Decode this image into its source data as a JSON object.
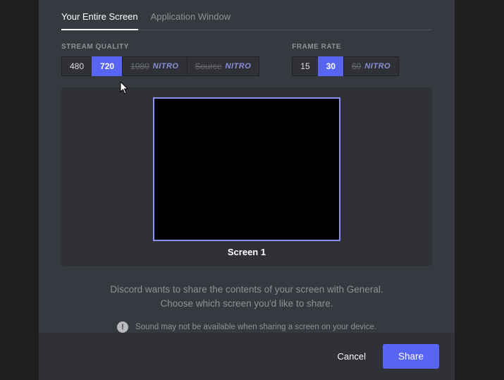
{
  "tabs": {
    "entire_screen": "Your Entire Screen",
    "application_window": "Application Window",
    "active_index": 0
  },
  "stream_quality": {
    "label": "STREAM QUALITY",
    "options": [
      {
        "text": "480",
        "selected": false,
        "locked": false
      },
      {
        "text": "720",
        "selected": true,
        "locked": false
      },
      {
        "text": "1080",
        "selected": false,
        "locked": true,
        "badge": "NITRO"
      },
      {
        "text": "Source",
        "selected": false,
        "locked": true,
        "badge": "NITRO"
      }
    ]
  },
  "frame_rate": {
    "label": "FRAME RATE",
    "options": [
      {
        "text": "15",
        "selected": false,
        "locked": false
      },
      {
        "text": "30",
        "selected": true,
        "locked": false
      },
      {
        "text": "60",
        "selected": false,
        "locked": true,
        "badge": "NITRO"
      }
    ]
  },
  "preview": {
    "screen_label": "Screen 1"
  },
  "info": {
    "line1": "Discord wants to share the contents of your screen with General.",
    "line2": "Choose which screen you'd like to share.",
    "sound_note": "Sound may not be available when sharing a screen on your device."
  },
  "footer": {
    "cancel": "Cancel",
    "share": "Share"
  },
  "colors": {
    "accent": "#5865f2",
    "bg_modal": "#36393f",
    "bg_inset": "#2f3136"
  }
}
